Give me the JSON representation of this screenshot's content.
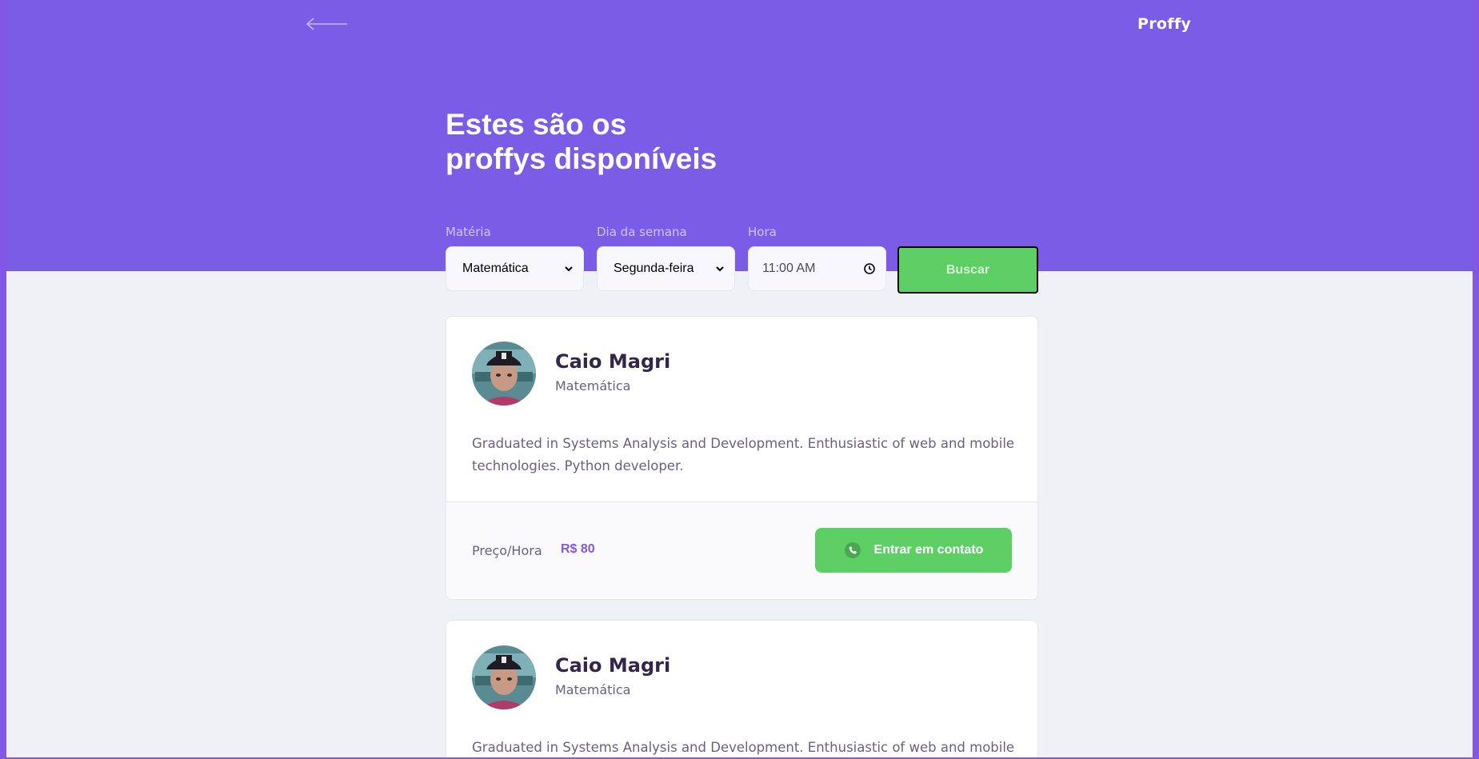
{
  "header": {
    "back_icon": "arrow-left-icon",
    "logo": "Proffy",
    "title_line1": "Estes são os",
    "title_line2": "proffys disponíveis"
  },
  "filters": {
    "subject": {
      "label": "Matéria",
      "value": "Matemática"
    },
    "weekday": {
      "label": "Dia da semana",
      "value": "Segunda-feira"
    },
    "time": {
      "label": "Hora",
      "value": "11:00 AM"
    },
    "search_label": "Buscar"
  },
  "teachers": [
    {
      "name": "Caio Magri",
      "subject": "Matemática",
      "bio": "Graduated in Systems Analysis and Development. Enthusiastic of web and mobile technologies. Python developer.",
      "price_label": "Preço/Hora",
      "price": "R$ 80",
      "contact_label": "Entrar em contato"
    },
    {
      "name": "Caio Magri",
      "subject": "Matemática",
      "bio": "Graduated in Systems Analysis and Development. Enthusiastic of web and mobile"
    }
  ],
  "colors": {
    "primary": "#8257e5",
    "header": "#7b5ce6",
    "secondary": "#5dcf65",
    "background": "#f0f0f7",
    "title_text": "#32264d",
    "body_text": "#6a6180"
  }
}
